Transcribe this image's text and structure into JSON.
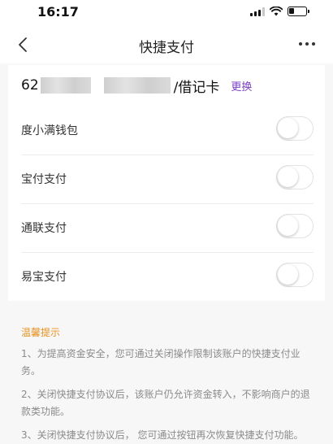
{
  "status_bar": {
    "time": "16:17"
  },
  "nav": {
    "title": "快捷支付"
  },
  "card": {
    "prefix": "62",
    "suffix": "/借记卡",
    "change_label": "更换"
  },
  "payment_methods": [
    {
      "label": "度小满钱包",
      "enabled": false
    },
    {
      "label": "宝付支付",
      "enabled": false
    },
    {
      "label": "通联支付",
      "enabled": false
    },
    {
      "label": "易宝支付",
      "enabled": false
    }
  ],
  "tips": {
    "title": "温馨提示",
    "items": [
      "1、为提高资金安全，您可通过关闭操作限制该账户的快捷支付业务。",
      "2、关闭快捷支付协议后，该账户仍允许资金转入，不影响商户的退款类功能。",
      "3、关闭快捷支付协议后， 您可通过按钮再次恢复快捷支付功能。"
    ]
  },
  "colors": {
    "accent": "#7b3fc4",
    "tips_title": "#e8911f",
    "tip_text": "#8a8a8a"
  }
}
